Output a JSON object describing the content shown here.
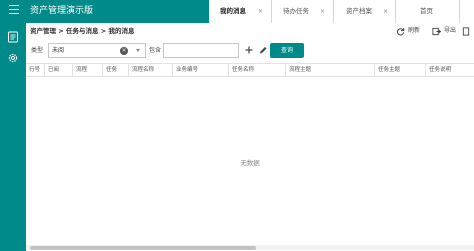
{
  "header": {
    "app_title": "资产管理演示版",
    "tabs": [
      {
        "label": "我的消息",
        "active": true
      },
      {
        "label": "待办任务",
        "active": false
      },
      {
        "label": "资产档案",
        "active": false
      },
      {
        "label": "首页",
        "active": false
      }
    ],
    "close_symbol": "×"
  },
  "breadcrumb": "资产管理 > 任务与消息 > 我的消息",
  "toolbar": {
    "refresh_label": "刷新",
    "export_label": "导出"
  },
  "filter": {
    "type_label": "类型",
    "type_value": "未阅",
    "contains_label": "包含",
    "contains_value": "",
    "query_label": "查询"
  },
  "table": {
    "columns": [
      "行号",
      "已阅",
      "流程",
      "任务",
      "流程名称",
      "业务编号",
      "任务名称",
      "流程主题",
      "任务主题",
      "任务说明"
    ],
    "rows": [],
    "empty_text": "无数据"
  },
  "icons": {
    "menu": "menu-icon",
    "sidebar_1": "document-list-icon",
    "sidebar_2": "gear-icon",
    "refresh": "refresh-icon",
    "export": "export-icon",
    "clear": "clear-icon",
    "dropdown": "chevron-down-icon",
    "add": "plus-icon",
    "edit": "pencil-icon"
  },
  "colors": {
    "accent": "#008a8a",
    "header_text": "#ffffff"
  }
}
